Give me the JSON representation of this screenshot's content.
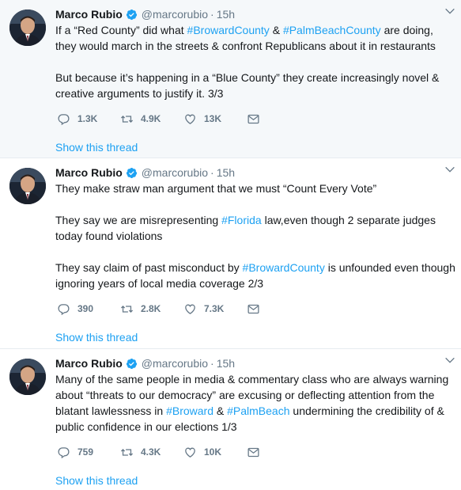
{
  "author": {
    "name": "Marco Rubio",
    "handle": "@marcorubio",
    "separator": "·"
  },
  "tweets": [
    {
      "time": "15h",
      "lines": [
        [
          {
            "t": "If a “Red County” did what "
          },
          {
            "t": "#BrowardCounty",
            "tag": true
          },
          {
            "t": " & "
          },
          {
            "t": "#PalmBeachCounty",
            "tag": true
          },
          {
            "t": " are doing,"
          }
        ],
        [
          {
            "t": "they would march in the streets & confront Republicans about it in restaurants"
          }
        ],
        [],
        [
          {
            "t": "But because it’s happening in a “Blue County” they create increasingly novel &"
          }
        ],
        [
          {
            "t": "creative arguments to justify it. 3/3"
          }
        ]
      ],
      "replies": "1.3K",
      "retweets": "4.9K",
      "likes": "13K",
      "thread_link": "Show this thread"
    },
    {
      "time": "15h",
      "lines": [
        [
          {
            "t": "They make straw man argument that we must “Count Every Vote”"
          }
        ],
        [],
        [
          {
            "t": "They say we are misrepresenting "
          },
          {
            "t": "#Florida",
            "tag": true
          },
          {
            "t": " law,even though 2 separate judges"
          }
        ],
        [
          {
            "t": "today found violations"
          }
        ],
        [],
        [
          {
            "t": "They say claim of past misconduct by "
          },
          {
            "t": "#BrowardCounty",
            "tag": true
          },
          {
            "t": " is unfounded even though"
          }
        ],
        [
          {
            "t": "ignoring years of local media coverage 2/3"
          }
        ]
      ],
      "replies": "390",
      "retweets": "2.8K",
      "likes": "7.3K",
      "thread_link": "Show this thread"
    },
    {
      "time": "15h",
      "lines": [
        [
          {
            "t": "Many of the same people in media & commentary class who are always warning"
          }
        ],
        [
          {
            "t": "about “threats to our democracy” are excusing or deflecting attention from the"
          }
        ],
        [
          {
            "t": "blatant lawlessness in "
          },
          {
            "t": "#Broward",
            "tag": true
          },
          {
            "t": " & "
          },
          {
            "t": "#PalmBeach",
            "tag": true
          },
          {
            "t": " undermining the credibility of &"
          }
        ],
        [
          {
            "t": "public confidence in our elections 1/3"
          }
        ]
      ],
      "replies": "759",
      "retweets": "4.3K",
      "likes": "10K",
      "thread_link": "Show this thread"
    }
  ],
  "colors": {
    "link": "#1da1f2",
    "muted": "#657786",
    "highlight_bg": "#f5f8fa"
  },
  "icons": [
    "reply-icon",
    "retweet-icon",
    "like-icon",
    "direct-message-icon",
    "verified-icon",
    "caret-down-icon"
  ]
}
